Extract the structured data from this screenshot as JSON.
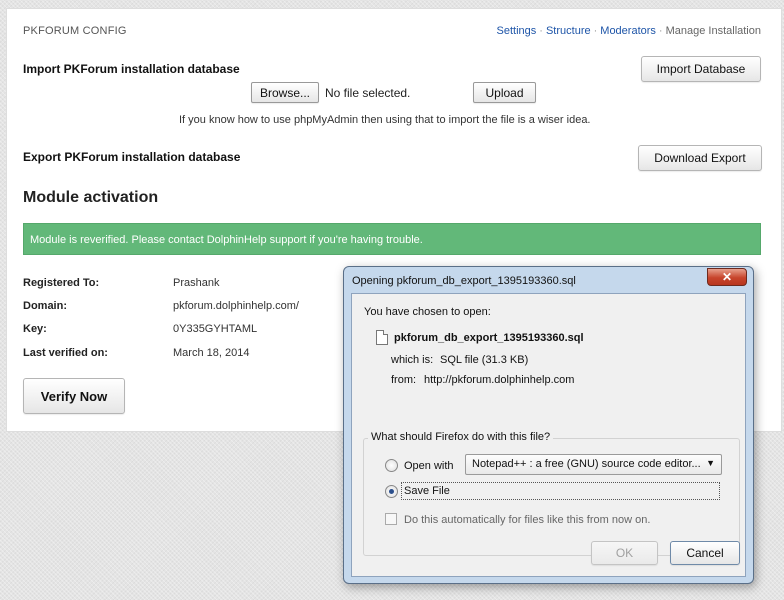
{
  "page": {
    "header_title": "PKFORUM CONFIG",
    "nav": {
      "settings": "Settings",
      "structure": "Structure",
      "moderators": "Moderators",
      "manage": "Manage Installation",
      "sep": "·"
    },
    "import": {
      "title": "Import PKForum installation database",
      "browse_label": "Browse...",
      "file_status": "No file selected.",
      "upload_label": "Upload",
      "import_button": "Import Database",
      "hint": "If you know how to use phpMyAdmin then using that to import the file is a wiser idea."
    },
    "export": {
      "title": "Export PKForum installation database",
      "download_button": "Download Export"
    },
    "module": {
      "title": "Module activation",
      "alert": "Module is reverified. Please contact DolphinHelp support if you're having trouble.",
      "rows": [
        {
          "label": "Registered To:",
          "value": "Prashank"
        },
        {
          "label": "Domain:",
          "value": "pkforum.dolphinhelp.com/"
        },
        {
          "label": "Key:",
          "value": "0Y335GYHTAML"
        },
        {
          "label": "Last verified on:",
          "value": "March 18, 2014"
        }
      ],
      "verify_button": "Verify Now"
    }
  },
  "dialog": {
    "title": "Opening pkforum_db_export_1395193360.sql",
    "close_glyph": "✕",
    "chosen_text": "You have chosen to open:",
    "filename": "pkforum_db_export_1395193360.sql",
    "which_is_label": "which is:",
    "which_is_value": "SQL file (31.3 KB)",
    "from_label": "from:",
    "from_value": "http://pkforum.dolphinhelp.com",
    "question": "What should Firefox do with this file?",
    "open_with_label": "Open with",
    "open_with_app": "Notepad++ : a free (GNU) source code editor...",
    "save_file_label": "Save File",
    "auto_label": "Do this automatically for files like this from now on.",
    "ok_label": "OK",
    "cancel_label": "Cancel",
    "selected_option": "save_file"
  }
}
